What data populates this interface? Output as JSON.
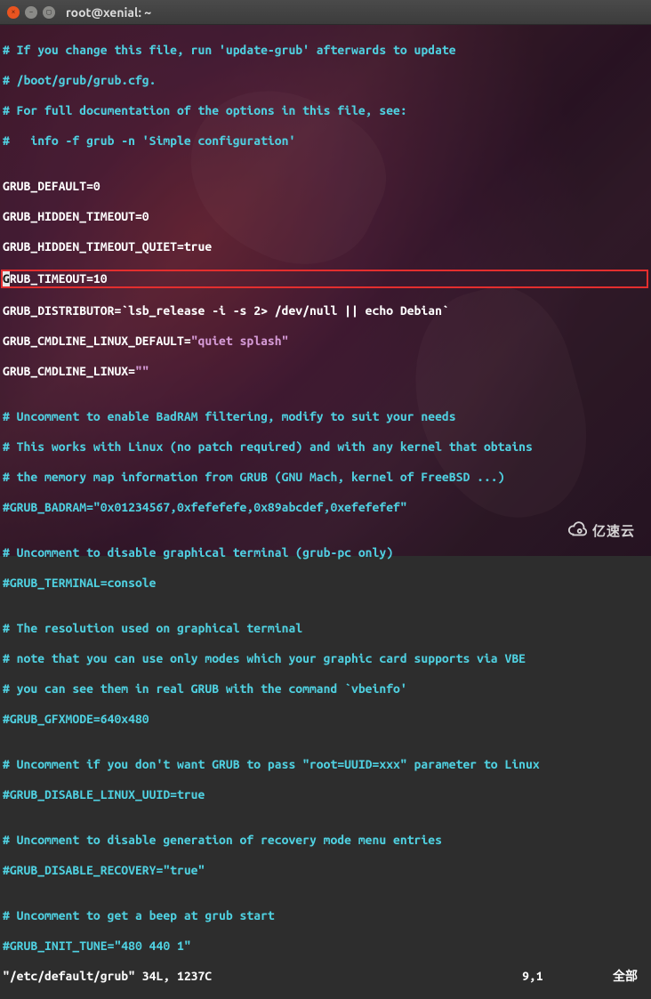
{
  "window": {
    "title": "root@xenial: ~",
    "controls": {
      "close": "×",
      "min": "–",
      "max": "▢"
    }
  },
  "content": {
    "l01": "# If you change this file, run 'update-grub' afterwards to update",
    "l02": "# /boot/grub/grub.cfg.",
    "l03": "# For full documentation of the options in this file, see:",
    "l04": "#   info -f grub -n 'Simple configuration'",
    "l05": "",
    "l06": "GRUB_DEFAULT=0",
    "l07": "GRUB_HIDDEN_TIMEOUT=0",
    "l08": "GRUB_HIDDEN_TIMEOUT_QUIET=true",
    "l09_cur": "G",
    "l09_rest": "RUB_TIMEOUT=10",
    "l10_a": "GRUB_DISTRIBUTOR=`lsb_release -i -s 2> /dev/null || echo Debian`",
    "l11_a": "GRUB_CMDLINE_LINUX_DEFAULT=",
    "l11_s": "\"quiet splash\"",
    "l12_a": "GRUB_CMDLINE_LINUX=",
    "l12_s": "\"\"",
    "l13": "",
    "l14": "# Uncomment to enable BadRAM filtering, modify to suit your needs",
    "l15": "# This works with Linux (no patch required) and with any kernel that obtains",
    "l16": "# the memory map information from GRUB (GNU Mach, kernel of FreeBSD ...)",
    "l17": "#GRUB_BADRAM=\"0x01234567,0xfefefefe,0x89abcdef,0xefefefef\"",
    "l18": "",
    "l19": "# Uncomment to disable graphical terminal (grub-pc only)",
    "l20": "#GRUB_TERMINAL=console",
    "l21": "",
    "l22": "# The resolution used on graphical terminal",
    "l23": "# note that you can use only modes which your graphic card supports via VBE",
    "l24": "# you can see them in real GRUB with the command `vbeinfo'",
    "l25": "#GRUB_GFXMODE=640x480",
    "l26": "",
    "l27": "# Uncomment if you don't want GRUB to pass \"root=UUID=xxx\" parameter to Linux",
    "l28": "#GRUB_DISABLE_LINUX_UUID=true",
    "l29": "",
    "l30": "# Uncomment to disable generation of recovery mode menu entries",
    "l31": "#GRUB_DISABLE_RECOVERY=\"true\"",
    "l32": "",
    "l33": "# Uncomment to get a beep at grub start",
    "l34": "#GRUB_INIT_TUNE=\"480 440 1\""
  },
  "status": {
    "left": "\"/etc/default/grub\" 34L, 1237C",
    "pos": "9,1",
    "right": "全部"
  },
  "watermark": {
    "text": "亿速云"
  }
}
